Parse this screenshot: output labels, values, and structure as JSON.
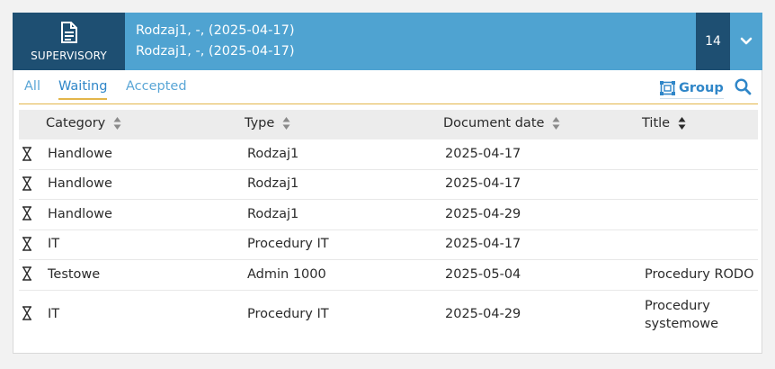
{
  "header": {
    "badge_label": "SUPERVISORY",
    "badge_icon": "document-icon",
    "line1": "Rodzaj1, -, (2025-04-17)",
    "line2": "Rodzaj1, -, (2025-04-17)",
    "count": "14",
    "expand_icon": "chevron-down-icon"
  },
  "tabs": [
    {
      "label": "All",
      "active": false
    },
    {
      "label": "Waiting",
      "active": true
    },
    {
      "label": "Accepted",
      "active": false
    }
  ],
  "toolbar": {
    "group_label": "Group",
    "group_icon": "group-icon",
    "search_icon": "search-icon"
  },
  "table": {
    "columns": [
      "Category",
      "Type",
      "Document date",
      "Title"
    ],
    "sort_icon": "sort-icon",
    "row_icon": "hourglass-icon",
    "rows": [
      {
        "category": "Handlowe",
        "type": "Rodzaj1",
        "date": "2025-04-17",
        "title": ""
      },
      {
        "category": "Handlowe",
        "type": "Rodzaj1",
        "date": "2025-04-17",
        "title": ""
      },
      {
        "category": "Handlowe",
        "type": "Rodzaj1",
        "date": "2025-04-29",
        "title": ""
      },
      {
        "category": "IT",
        "type": "Procedury IT",
        "date": "2025-04-17",
        "title": ""
      },
      {
        "category": "Testowe",
        "type": "Admin 1000",
        "date": "2025-05-04",
        "title": "Procedury RODO"
      },
      {
        "category": "IT",
        "type": "Procedury IT",
        "date": "2025-04-29",
        "title": "Procedury systemowe"
      }
    ]
  },
  "colors": {
    "header_blue": "#4fa3d1",
    "header_dark": "#1e4f72",
    "accent_gold": "#e3b64a",
    "link_blue": "#2f86c8"
  }
}
